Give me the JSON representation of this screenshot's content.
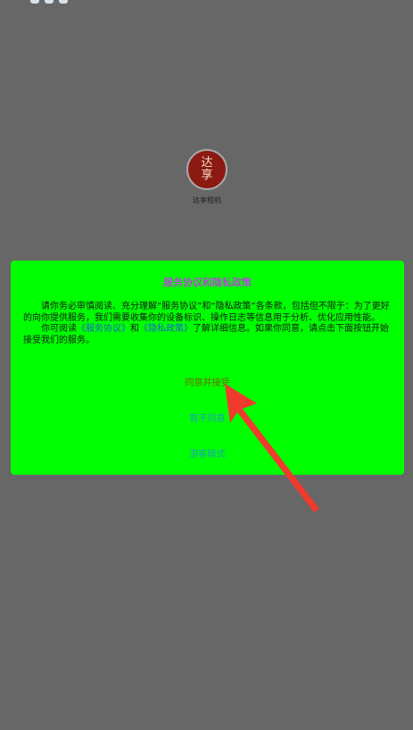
{
  "splash": {
    "logo_text_line1": "达",
    "logo_text_line2": "享",
    "app_name": "达享租机"
  },
  "dialog": {
    "title": "服务协议和隐私政策",
    "paragraph1": "请你务必审慎阅读、充分理解“服务协议”和“隐私政策”各条款，包括但不限于：为了更好的向你提供服务，我们需要收集你的设备标识、操作日志等信息用于分析、优化应用性能。",
    "paragraph2_prefix": "你可阅读",
    "service_link": "《服务协议》",
    "and_text": "和",
    "privacy_link": "《隐私政策》",
    "paragraph2_suffix": "了解详细信息。如果你同意，请点击下面按钮开始接受我们的服务。",
    "agree_label": "同意并接受",
    "disagree_label": "暂不同意",
    "guest_label": "游客模式"
  },
  "colors": {
    "overlay": "#676767",
    "dialog_bg": "#00ff00",
    "title": "#b04cd0",
    "link": "#1d63c6",
    "arrow": "#f03a2e"
  }
}
